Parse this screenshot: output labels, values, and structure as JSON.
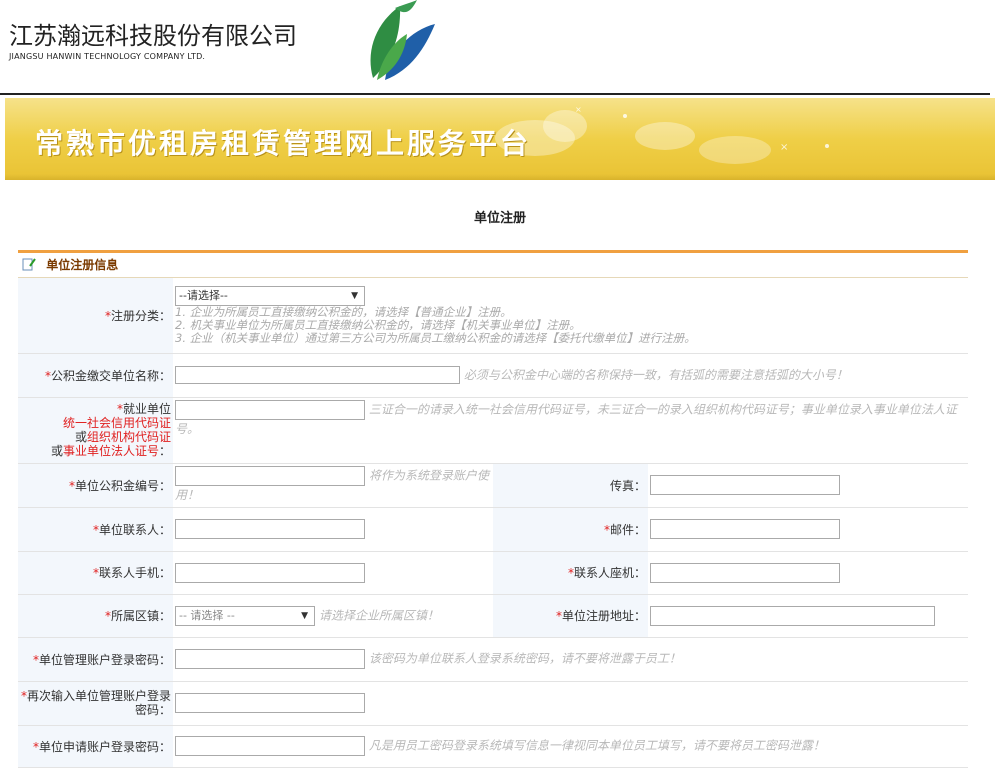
{
  "header": {
    "company_cn": "江苏瀚远科技股份有限公司",
    "company_en": "JIANGSU HANWIN TECHNOLOGY COMPANY LTD.",
    "banner_title": "常熟市优租房租赁管理网上服务平台",
    "logo_icon": "company-leaf-logo",
    "banner_color": "#efcf47"
  },
  "page": {
    "title": "单位注册"
  },
  "section": {
    "title": "单位注册信息"
  },
  "form": {
    "reg_type": {
      "label": "注册分类：",
      "value": "--请选择--",
      "notes": [
        "1. 企业为所属员工直接缴纳公积金的，请选择【普通企业】注册。",
        "2. 机关事业单位为所属员工直接缴纳公积金的，请选择【机关事业单位】注册。",
        "3. 企业（机关事业单位）通过第三方公司为所属员工缴纳公积金的请选择【委托代缴单位】进行注册。"
      ]
    },
    "unit_name": {
      "label": "公积金缴交单位名称：",
      "hint": "必须与公积金中心端的名称保持一致，有括弧的需要注意括弧的大小号！"
    },
    "credit_code": {
      "label_1": "就业单位",
      "label_2": "统一社会信用代码证",
      "label_3_prefix": "或",
      "label_3_red": "组织机构代码证",
      "label_4_prefix": "或",
      "label_4_red": "事业单位法人证号",
      "label_4_suffix": "：",
      "hint": "三证合一的请录入统一社会信用代码证号，未三证合一的录入组织机构代码证号；事业单位录入事业单位法人证号。"
    },
    "fund_no": {
      "label": "单位公积金编号：",
      "hint": "将作为系统登录账户使用！"
    },
    "fax": {
      "label": "传真："
    },
    "contact": {
      "label": "单位联系人："
    },
    "email": {
      "label": "邮件："
    },
    "mobile": {
      "label": "联系人手机："
    },
    "phone": {
      "label": "联系人座机："
    },
    "district": {
      "label": "所属区镇：",
      "value": "-- 请选择 --",
      "hint": "请选择企业所属区镇！"
    },
    "address": {
      "label": "单位注册地址："
    },
    "admin_pwd": {
      "label": "单位管理账户登录密码：",
      "hint": "该密码为单位联系人登录系统密码，请不要将泄露于员工！"
    },
    "admin_pwd2": {
      "label": "再次输入单位管理账户登录密码："
    },
    "apply_pwd": {
      "label": "单位申请账户登录密码：",
      "hint": "凡是用员工密码登录系统填写信息一律视同本单位员工填写，请不要将员工密码泄露！"
    }
  }
}
